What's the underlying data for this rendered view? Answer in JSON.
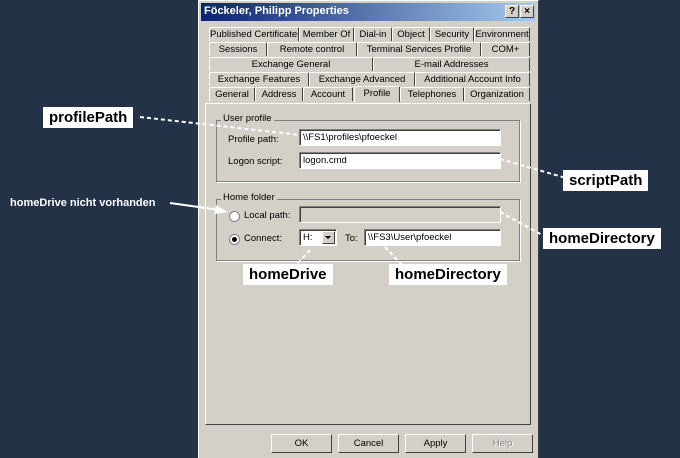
{
  "dialog": {
    "title": "Föckeler, Philipp Properties",
    "help_glyph": "?",
    "close_glyph": "×"
  },
  "tabs": {
    "row1": [
      "Published Certificates",
      "Member Of",
      "Dial-in",
      "Object",
      "Security",
      "Environment"
    ],
    "row2": [
      "Sessions",
      "Remote control",
      "Terminal Services Profile",
      "COM+"
    ],
    "row3": [
      "Exchange General",
      "E-mail Addresses"
    ],
    "row4": [
      "Exchange Features",
      "Exchange Advanced",
      "Additional Account Info"
    ],
    "row5": [
      "General",
      "Address",
      "Account",
      "Profile",
      "Telephones",
      "Organization"
    ],
    "active": "Profile"
  },
  "user_profile": {
    "group_label": "User profile",
    "profile_path_label": "Profile path:",
    "profile_path_value": "\\\\FS1\\profiles\\pfoeckel",
    "logon_script_label": "Logon script:",
    "logon_script_value": "logon.cmd"
  },
  "home_folder": {
    "group_label": "Home folder",
    "local_path_label": "Local path:",
    "local_path_value": "",
    "connect_label": "Connect:",
    "drive_value": "H:",
    "to_label": "To:",
    "to_value": "\\\\FS3\\User\\pfoeckel"
  },
  "buttons": {
    "ok": "OK",
    "cancel": "Cancel",
    "apply": "Apply",
    "help": "Help"
  },
  "annotations": {
    "profilePath": "profilePath",
    "scriptPath": "scriptPath",
    "homeDrive_note": "homeDrive nicht vorhanden",
    "homeDirectory_right": "homeDirectory",
    "homeDrive": "homeDrive",
    "homeDirectory_bottom": "homeDirectory"
  },
  "colors": {
    "background": "#233247",
    "dialog": "#d4d0c8",
    "titlebar": "#0a246a",
    "callout": "#ffffff"
  }
}
